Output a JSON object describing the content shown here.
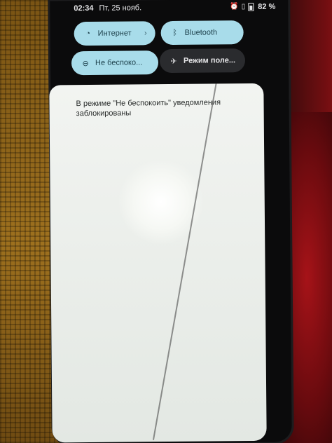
{
  "status_bar": {
    "time": "02:34",
    "date": "Пт, 25 нояб.",
    "icons": [
      "alarm-icon",
      "vibrate-icon",
      "battery-icon"
    ],
    "battery_percent": "82 %"
  },
  "quick_settings": {
    "tiles": [
      {
        "label": "Интернет",
        "icon": "wifi-icon",
        "state": "on",
        "has_chevron": true
      },
      {
        "label": "Bluetooth",
        "icon": "bluetooth-icon",
        "state": "on",
        "has_chevron": false
      },
      {
        "label": "Не беспоко...",
        "icon": "dnd-icon",
        "state": "on",
        "has_chevron": false
      },
      {
        "label": "Режим поле...",
        "icon": "airplane-icon",
        "state": "off",
        "has_chevron": false
      }
    ]
  },
  "notifications": {
    "dnd_message": "В режиме \"Не беспокоить\" уведомления заблокированы"
  },
  "colors": {
    "tile_on": "#a8dcea",
    "tile_off": "#2a2b2e",
    "panel": "#eef1ed"
  }
}
